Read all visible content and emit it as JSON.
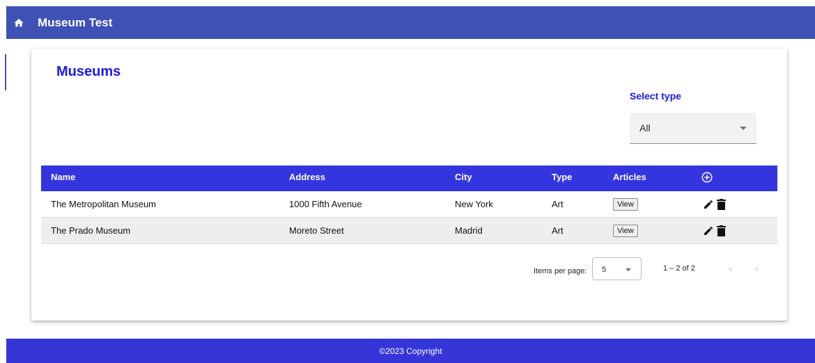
{
  "header": {
    "title": "Museum Test",
    "home_icon": "home-icon"
  },
  "page": {
    "title": "Museums"
  },
  "filter": {
    "label": "Select type",
    "selected": "All"
  },
  "table": {
    "columns": [
      "Name",
      "Address",
      "City",
      "Type",
      "Articles"
    ],
    "rows": [
      {
        "name": "The Metropolitan Museum",
        "address": "1000 Fifth Avenue",
        "city": "New York",
        "type": "Art",
        "articles_label": "View"
      },
      {
        "name": "The Prado Museum",
        "address": "Moreto Street",
        "city": "Madrid",
        "type": "Art",
        "articles_label": "View"
      }
    ]
  },
  "paginator": {
    "items_per_page_label": "Items per page:",
    "items_per_page": "5",
    "range": "1 – 2 of 2"
  },
  "footer": {
    "text": "©2023 Copyright"
  },
  "colors": {
    "toolbar": "#3f51b5",
    "table_header": "#3535e0",
    "title": "#1a1ae6",
    "footer": "#3535d8"
  }
}
